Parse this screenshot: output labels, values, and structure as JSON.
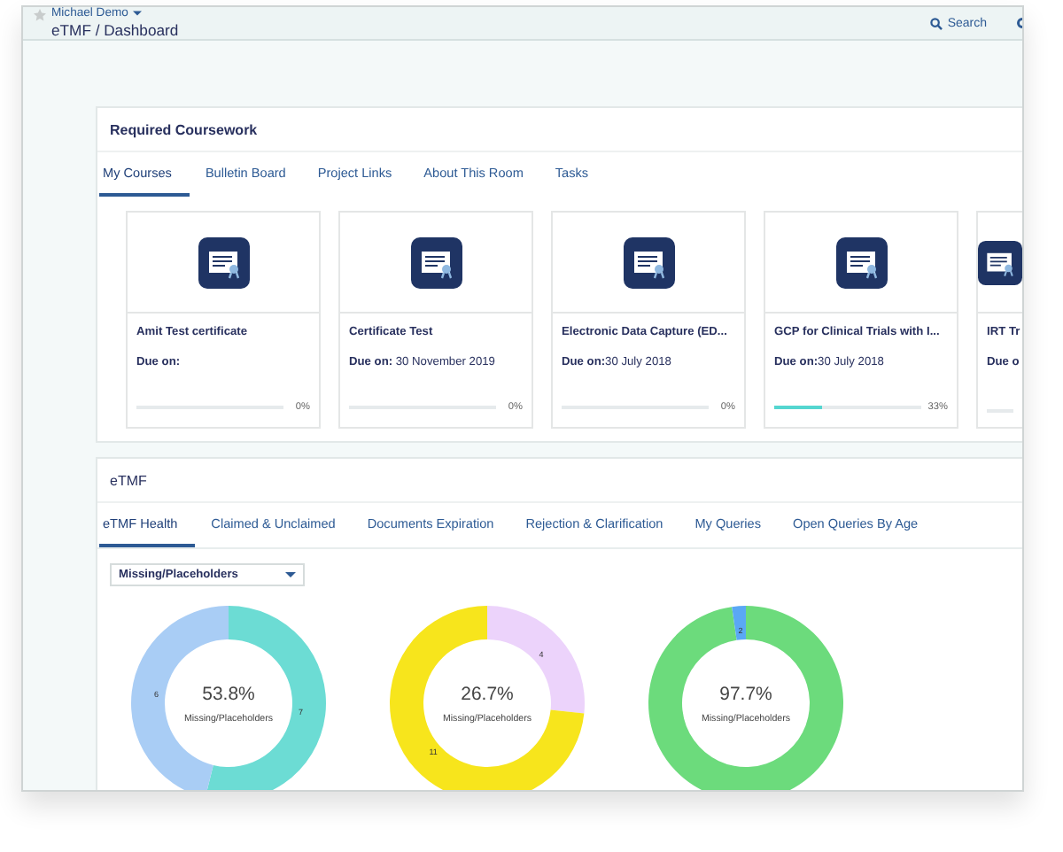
{
  "header": {
    "user": "Michael Demo",
    "breadcrumb": "eTMF / Dashboard",
    "search_label": "Search"
  },
  "coursework": {
    "title": "Required Coursework",
    "tabs": [
      {
        "label": "My Courses",
        "selected": true
      },
      {
        "label": "Bulletin Board",
        "selected": false
      },
      {
        "label": "Project Links",
        "selected": false
      },
      {
        "label": "About This Room",
        "selected": false
      },
      {
        "label": "Tasks",
        "selected": false
      }
    ],
    "courses": [
      {
        "title": "Amit Test certificate",
        "due": "**Due on:**",
        "level": 0,
        "percent": "0%"
      },
      {
        "title": "Certificate Test",
        "due": "**Due on:** 30 November 2019",
        "level": 0,
        "percent": "0%"
      },
      {
        "title": "Electronic Data Capture (ED...",
        "due": "**Due on:**30 July 2018",
        "level": 0,
        "percent": "0%"
      },
      {
        "title": "GCP for Clinical Trials with I...",
        "due": "**Due on:**30 July 2018",
        "level": 0.33,
        "percent": "33%"
      },
      {
        "title": "IRT Tr",
        "due": "**Due o**",
        "level": 0
      }
    ]
  },
  "etmf": {
    "title": "eTMF",
    "tabs": [
      {
        "label": "eTMF Health",
        "selected": true
      },
      {
        "label": "Claimed & Unclaimed",
        "selected": false
      },
      {
        "label": "Documents Expiration",
        "selected": false
      },
      {
        "label": "Rejection & Clarification",
        "selected": false
      },
      {
        "label": "My Queries",
        "selected": false
      },
      {
        "label": "Open Queries By Age",
        "selected": false
      }
    ],
    "dropdown": {
      "value": "Missing/Placeholders"
    },
    "donuts": [
      {
        "center_value": "53.8%",
        "center_label": "Missing/Placeholders",
        "chart_data": {
          "type": "donut",
          "values": [
            7,
            6
          ],
          "colors": [
            "#6cdcd4",
            "#a9cdf5"
          ],
          "value_labels": [
            "7",
            "6"
          ]
        }
      },
      {
        "center_value": "26.7%",
        "center_label": "Missing/Placeholders",
        "chart_data": {
          "type": "donut",
          "values": [
            4,
            11
          ],
          "colors": [
            "#ecd3fb",
            "#f7e51c"
          ],
          "value_labels": [
            "4",
            "11"
          ]
        }
      },
      {
        "center_value": "97.7%",
        "center_label": "Missing/Placeholders",
        "chart_data": {
          "type": "donut",
          "values": [
            85,
            2
          ],
          "colors": [
            "#6cdb7c",
            "#5aa8f5"
          ],
          "value_labels": [
            null,
            "2"
          ]
        }
      }
    ]
  }
}
